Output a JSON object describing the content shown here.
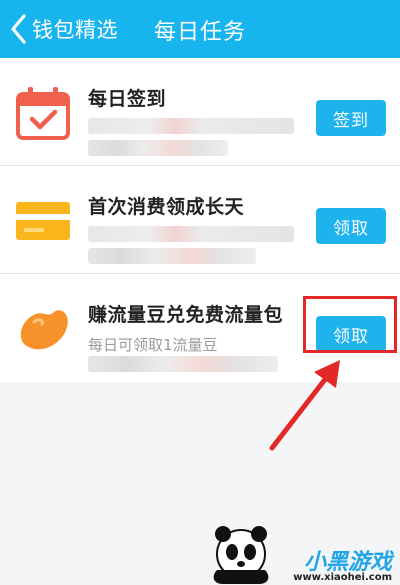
{
  "header": {
    "back_label": "钱包精选",
    "title": "每日任务"
  },
  "tasks": [
    {
      "title": "每日签到",
      "subtitle": "",
      "button": "签到",
      "icon": "calendar-check-icon"
    },
    {
      "title": "首次消费领成长天",
      "subtitle": "",
      "button": "领取",
      "icon": "card-icon"
    },
    {
      "title": "赚流量豆兑免费流量包",
      "subtitle": "每日可领取1流量豆",
      "button": "领取",
      "icon": "bean-icon"
    }
  ],
  "watermark": {
    "brand": "小黑游戏",
    "url": "www.xiaohei.com"
  },
  "colors": {
    "header": "#18b4ed",
    "button": "#1fb3ee",
    "highlight": "#e42727"
  }
}
